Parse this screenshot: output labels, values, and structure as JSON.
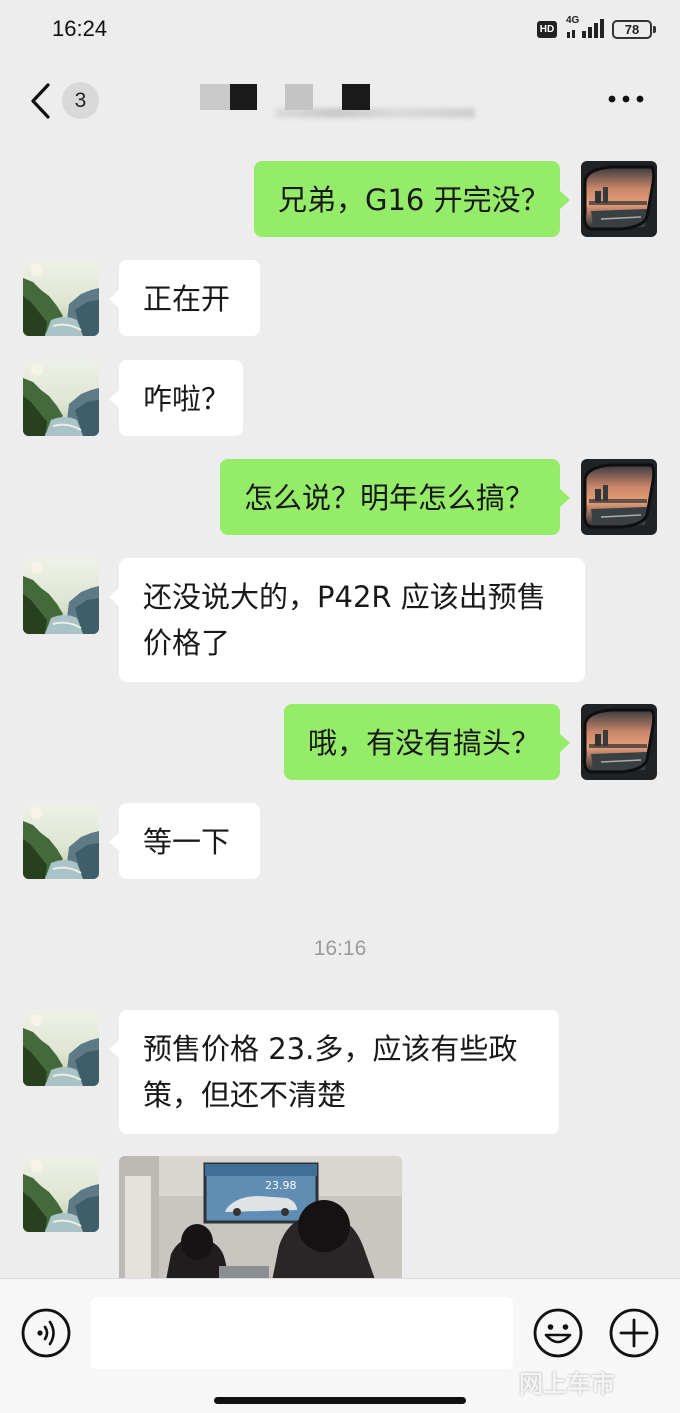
{
  "status_bar": {
    "time": "16:24",
    "hd": "HD",
    "network": "4G",
    "battery": "78"
  },
  "header": {
    "unread_count": "3",
    "title": ""
  },
  "messages": [
    {
      "side": "out",
      "text": "兄弟，G16 开完没？"
    },
    {
      "side": "in",
      "text": "正在开"
    },
    {
      "side": "in",
      "text": "咋啦？"
    },
    {
      "side": "out",
      "text": "怎么说？明年怎么搞？"
    },
    {
      "side": "in",
      "text": "还没说大的，P42R 应该出预售\n价格了"
    },
    {
      "side": "out",
      "text": "哦，有没有搞头？"
    },
    {
      "side": "in",
      "text": "等一下"
    },
    {
      "side": "in",
      "text": "预售价格 23.多，应该有些政\n策，但还不清楚"
    }
  ],
  "timestamp": "16:16",
  "image_message": {
    "screen_price": "23.98"
  },
  "input_bar": {
    "placeholder": "",
    "watermark": "网上车市"
  },
  "colors": {
    "background": "#ededed",
    "outgoing_bubble": "#95ec69",
    "incoming_bubble": "#ffffff",
    "timestamp": "#9b9b9b"
  }
}
